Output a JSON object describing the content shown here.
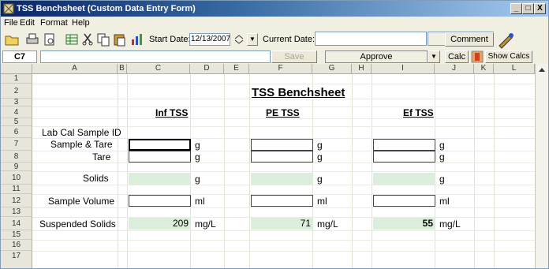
{
  "window": {
    "title": "TSS Benchsheet (Custom Data Entry Form)",
    "controls": {
      "minimize": "_",
      "maximize": "□",
      "close": "X"
    }
  },
  "menu": {
    "items": [
      "File",
      "Edit",
      "Format",
      "Help"
    ]
  },
  "toolbar": {
    "start_date_label": "Start Date:",
    "start_date_value": "12/13/2007",
    "current_date_label": "Current Date:",
    "current_date_value": "",
    "comment_label": "Comment"
  },
  "formula_bar": {
    "cell_ref": "C7",
    "save_label": "Save",
    "approve_value": "Approve",
    "calc_label": "Calc",
    "show_calcs_label": "Show Calcs"
  },
  "grid": {
    "columns": [
      "A",
      "B",
      "C",
      "D",
      "E",
      "F",
      "G",
      "H",
      "I",
      "J",
      "K",
      "L"
    ],
    "rows": [
      "1",
      "2",
      "3",
      "4",
      "5",
      "6",
      "7",
      "8",
      "9",
      "10",
      "11",
      "12",
      "13",
      "14",
      "15",
      "16",
      "17"
    ]
  },
  "sheet": {
    "title": "TSS Benchsheet",
    "sections": [
      "Inf TSS",
      "PE TSS",
      "Ef TSS"
    ],
    "labels": {
      "lab_cal_sample_id": "Lab Cal Sample ID",
      "sample_tare": "Sample & Tare",
      "tare": "Tare",
      "solids": "Solids",
      "sample_volume": "Sample Volume",
      "suspended_solids": "Suspended Solids"
    },
    "units": {
      "g": "g",
      "ml": "ml",
      "mgl": "mg/L"
    },
    "results": {
      "inf": "209",
      "pe": "71",
      "ef": "55"
    }
  },
  "colors": {
    "accent": "#0a246a",
    "input_green": "#dbeedc"
  }
}
